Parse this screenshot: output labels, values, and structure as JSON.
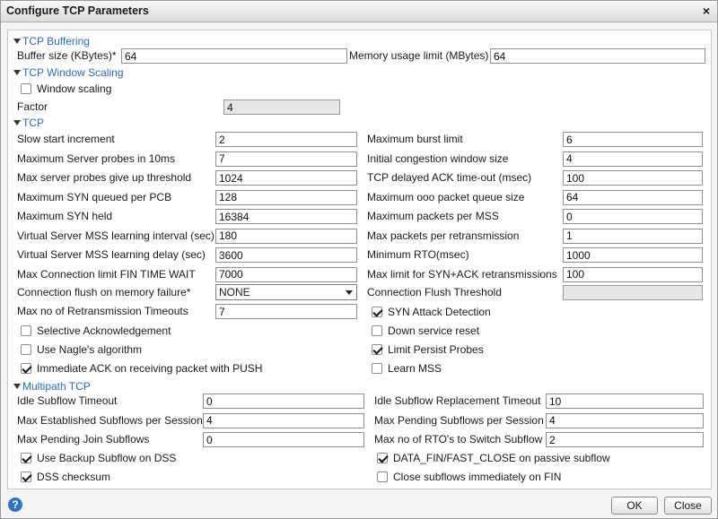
{
  "window": {
    "title": "Configure TCP Parameters",
    "close_glyph": "×"
  },
  "buffering": {
    "header": "TCP Buffering",
    "buffer_size_label": "Buffer size (KBytes)*",
    "buffer_size_value": "64",
    "memory_limit_label": "Memory usage limit (MBytes)",
    "memory_limit_value": "64"
  },
  "window_scaling": {
    "header": "TCP Window Scaling",
    "checkbox_label": "Window scaling",
    "checked": false,
    "factor_label": "Factor",
    "factor_value": "4"
  },
  "tcp": {
    "header": "TCP",
    "left_fields": [
      {
        "label": "Slow start increment",
        "value": "2"
      },
      {
        "label": "Maximum Server probes in 10ms",
        "value": "7"
      },
      {
        "label": "Max server probes give up threshold",
        "value": "1024"
      },
      {
        "label": "Maximum SYN queued per PCB",
        "value": "128"
      },
      {
        "label": "Maximum SYN held",
        "value": "16384"
      },
      {
        "label": "Virtual Server MSS learning interval (sec)",
        "value": "180"
      },
      {
        "label": "Virtual Server MSS learning delay (sec)",
        "value": "3600"
      },
      {
        "label": "Max Connection limit FIN TIME WAIT",
        "value": "7000"
      }
    ],
    "right_fields": [
      {
        "label": "Maximum burst limit",
        "value": "6"
      },
      {
        "label": "Initial congestion window size",
        "value": "4"
      },
      {
        "label": "TCP delayed ACK time-out (msec)",
        "value": "100"
      },
      {
        "label": "Maximum ooo packet queue size",
        "value": "64"
      },
      {
        "label": "Maximum packets per MSS",
        "value": "0"
      },
      {
        "label": "Max packets per retransmission",
        "value": "1"
      },
      {
        "label": "Minimum RTO(msec)",
        "value": "1000"
      },
      {
        "label": "Max limit for SYN+ACK retransmissions",
        "value": "100"
      }
    ],
    "flush_label": "Connection flush on memory failure*",
    "flush_value": "NONE",
    "flush_threshold_label": "Connection Flush Threshold",
    "flush_threshold_value": "",
    "retrans_label": "Max no of Retransmission Timeouts",
    "retrans_value": "7",
    "checkboxes_left": [
      {
        "label": "Selective Acknowledgement",
        "checked": false
      },
      {
        "label": "Use Nagle's algorithm",
        "checked": false
      },
      {
        "label": "Immediate ACK on receiving packet with PUSH",
        "checked": true
      }
    ],
    "checkboxes_right": [
      {
        "label": "SYN Attack Detection",
        "checked": true
      },
      {
        "label": "Down service reset",
        "checked": false
      },
      {
        "label": "Limit Persist Probes",
        "checked": true
      },
      {
        "label": "Learn MSS",
        "checked": false
      }
    ]
  },
  "multipath": {
    "header": "Multipath TCP",
    "left_fields": [
      {
        "label": "Idle Subflow Timeout",
        "value": "0"
      },
      {
        "label": "Max Established Subflows per Session",
        "value": "4"
      },
      {
        "label": "Max Pending Join Subflows",
        "value": "0"
      }
    ],
    "right_fields": [
      {
        "label": "Idle Subflow Replacement Timeout",
        "value": "10"
      },
      {
        "label": "Max Pending Subflows per Session",
        "value": "4"
      },
      {
        "label": "Max no of RTO's to Switch Subflow",
        "value": "2"
      }
    ],
    "checkboxes_left": [
      {
        "label": "Use Backup Subflow on DSS",
        "checked": true
      },
      {
        "label": "DSS checksum",
        "checked": true
      }
    ],
    "checkboxes_right": [
      {
        "label": "DATA_FIN/FAST_CLOSE on passive subflow",
        "checked": true
      },
      {
        "label": "Close subflows immediately on FIN",
        "checked": false
      }
    ]
  },
  "footer": {
    "help_glyph": "?",
    "ok_label": "OK",
    "close_label": "Close"
  }
}
